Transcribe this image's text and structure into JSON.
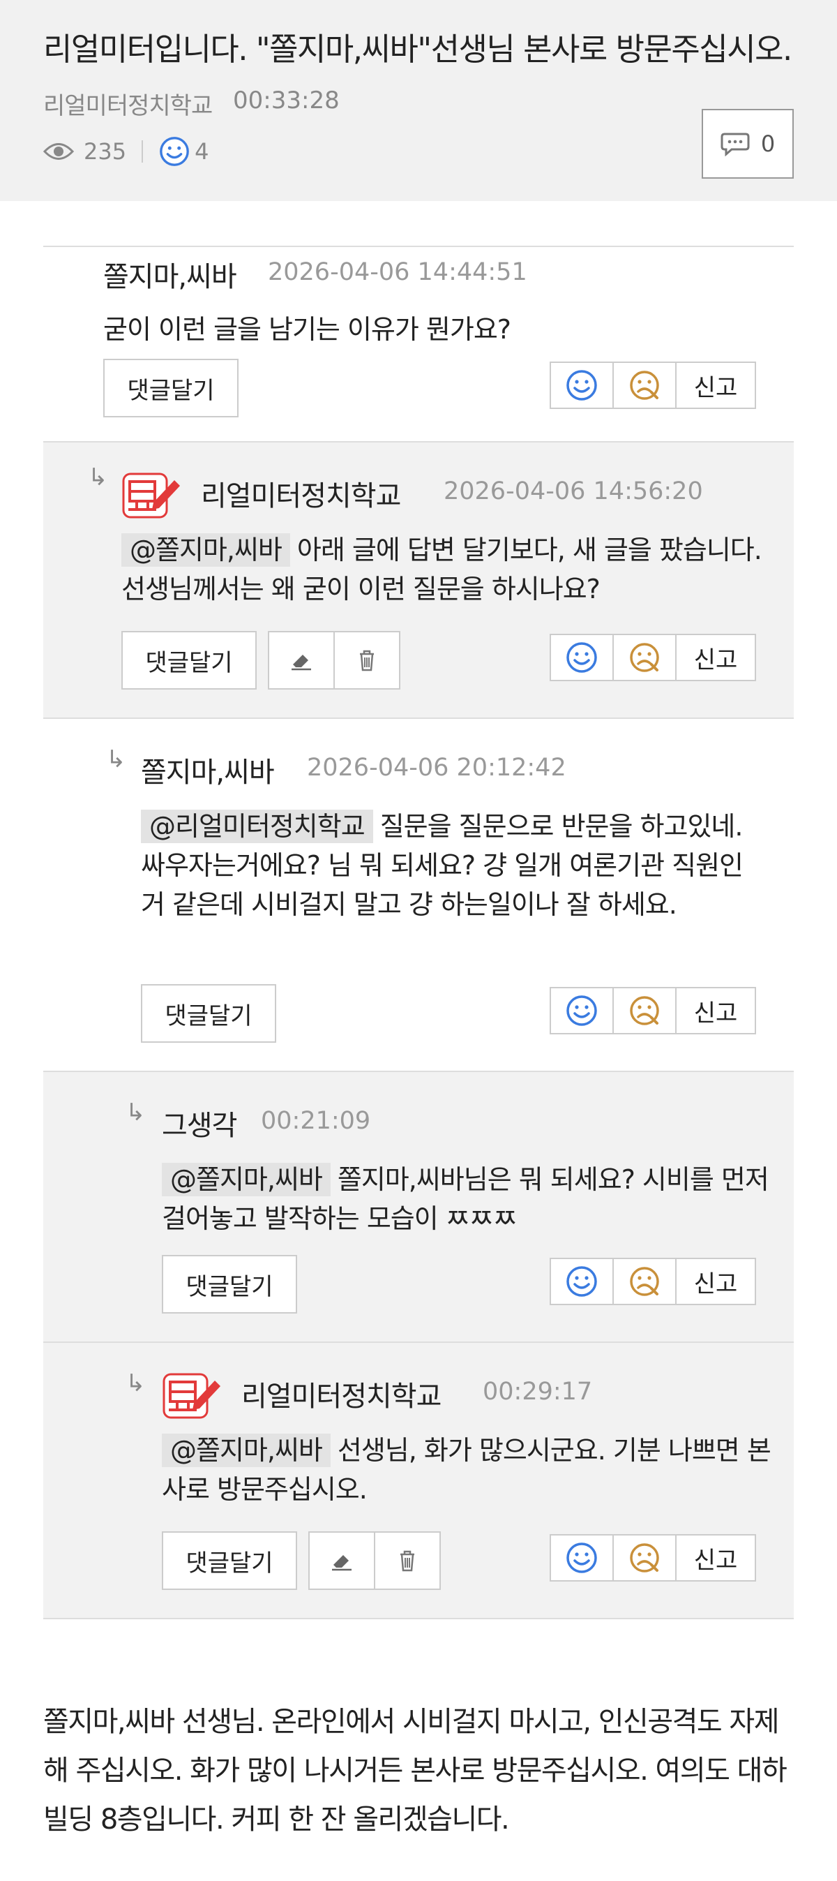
{
  "post": {
    "title": "리얼미터입니다. \"쫄지마,씨바\"선생님 본사로 방문주십시오.",
    "author": "리얼미터정치학교",
    "time": "00:33:28",
    "views": "235",
    "likes": "4",
    "comment_count": "0"
  },
  "labels": {
    "reply": "댓글달기",
    "report": "신고"
  },
  "icons": {
    "views": "eye-icon",
    "likes": "smile-icon",
    "comments": "speech-bubble-icon",
    "edit": "eraser-icon",
    "delete": "trash-icon",
    "dislike": "sad-face-icon",
    "badge": "official-badge-icon"
  },
  "colors": {
    "accent_blue": "#3a7be0",
    "dislike_orange": "#c9903a",
    "badge_red": "#e23a3a",
    "shaded_bg": "#f2f2f2"
  },
  "comments": [
    {
      "author": "쫄지마,씨바",
      "time": "2026-04-06 14:44:51",
      "text": "굳이 이런 글을 남기는 이유가 뭔가요?"
    },
    {
      "author": "리얼미터정치학교",
      "time": "2026-04-06 14:56:20",
      "mention": "@쫄지마,씨바",
      "text": "아래 글에 답변 달기보다, 새 글을 팠습니다. 선생님께서는 왜 굳이 이런 질문을 하시나요?"
    },
    {
      "author": "쫄지마,씨바",
      "time": "2026-04-06 20:12:42",
      "mention": "@리얼미터정치학교",
      "text": "질문을 질문으로 반문을 하고있네. 싸우자는거에요? 님 뭐 되세요? 걍 일개 여론기관 직원인거 같은데 시비걸지 말고 걍 하는일이나 잘 하세요."
    },
    {
      "author": "그생각",
      "time": "00:21:09",
      "mention": "@쫄지마,씨바",
      "text": "쫄지마,씨바님은 뭐 되세요? 시비를 먼저 걸어놓고 발작하는 모습이 ㅉㅉㅉ"
    },
    {
      "author": "리얼미터정치학교",
      "time": "00:29:17",
      "mention": "@쫄지마,씨바",
      "text": "선생님, 화가 많으시군요. 기분 나쁘면 본사로 방문주십시오."
    }
  ],
  "bottom_text": "쫄지마,씨바 선생님. 온라인에서 시비걸지 마시고, 인신공격도 자제해 주십시오. 화가 많이 나시거든 본사로 방문주십시오. 여의도 대하빌딩 8층입니다. 커피 한 잔 올리겠습니다."
}
